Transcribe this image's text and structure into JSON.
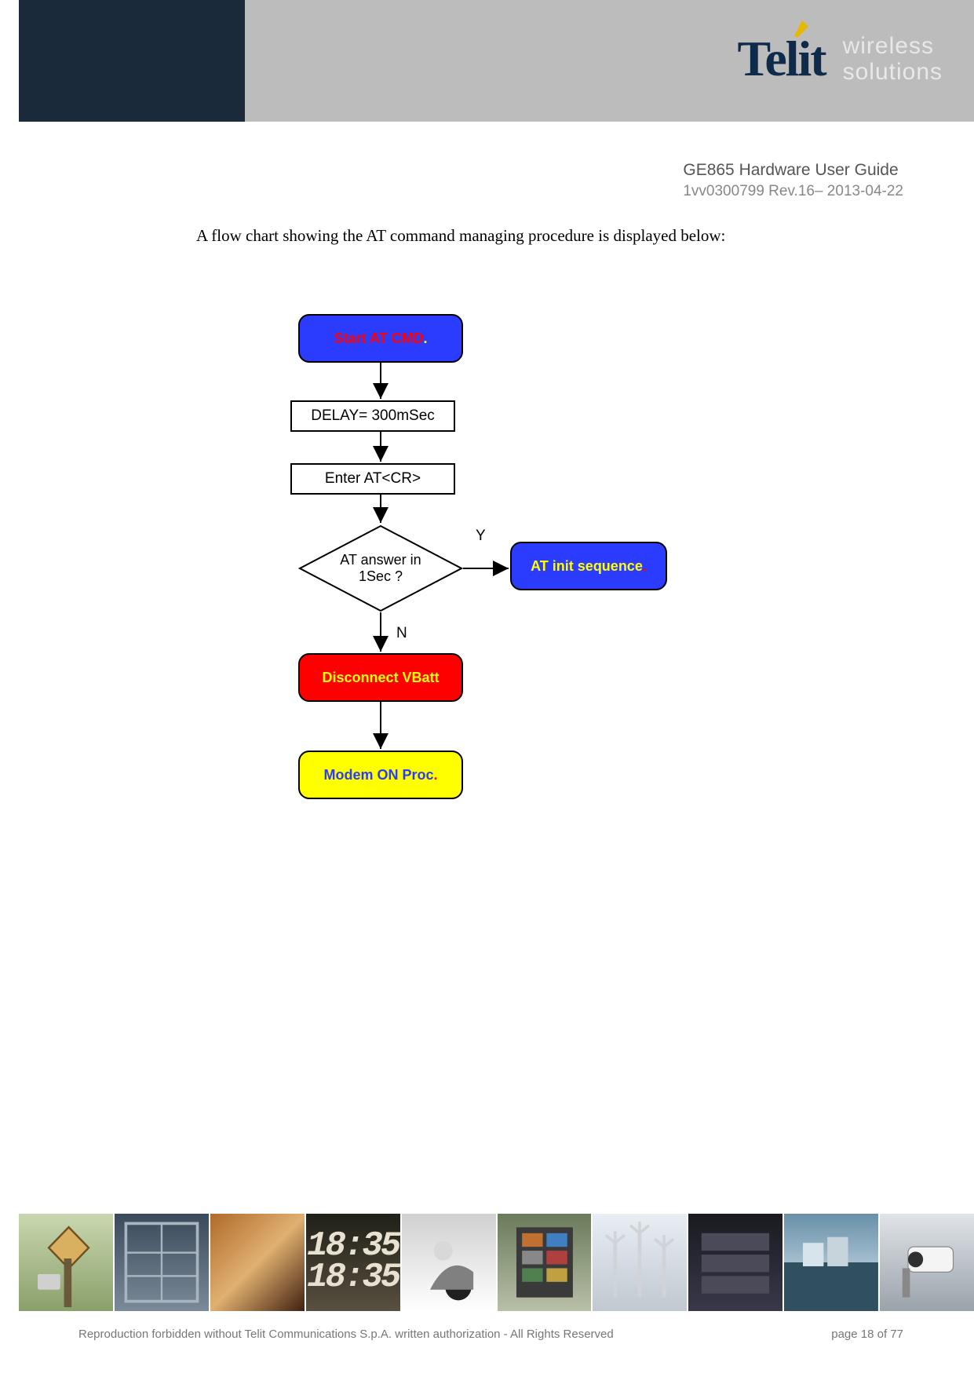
{
  "header": {
    "brand": "Telit",
    "tagline_line1": "wireless",
    "tagline_line2": "solutions"
  },
  "doc": {
    "title": "GE865 Hardware User Guide",
    "revision": "1vv0300799 Rev.16– 2013-04-22"
  },
  "body": {
    "intro": "A flow chart showing the AT command managing procedure is displayed below:"
  },
  "flowchart": {
    "start": "Start AT CMD",
    "start_dot": ".",
    "delay": "DELAY= 300mSec",
    "enter": "Enter AT<CR>",
    "decision_line1": "AT answer in",
    "decision_line2": "1Sec ?",
    "label_yes": "Y",
    "label_no": "N",
    "init": "AT init sequence",
    "init_dot": ".",
    "disconnect": "Disconnect VBatt",
    "modem": "Modem ON Proc",
    "modem_dot": "."
  },
  "footer": {
    "ft4_top": "18:35",
    "ft4_bot": "18:35",
    "copyright": "Reproduction forbidden without Telit Communications S.p.A. written authorization - All Rights Reserved",
    "page": "page 18 of 77"
  }
}
